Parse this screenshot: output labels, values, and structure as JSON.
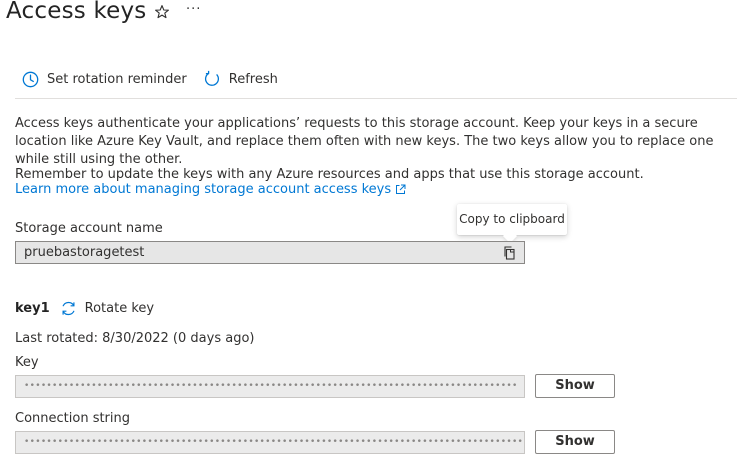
{
  "header": {
    "title": "Access keys",
    "more_label": "···"
  },
  "toolbar": {
    "set_rotation_reminder": "Set rotation reminder",
    "refresh": "Refresh"
  },
  "info": {
    "description": "Access keys authenticate your applications’ requests to this storage account. Keep your keys in a secure location like Azure Key Vault, and replace them often with new keys. The two keys allow you to replace one while still using the other.",
    "reminder": "Remember to update the keys with any Azure resources and apps that use this storage account.",
    "learn_more_link": "Learn more about managing storage account access keys"
  },
  "storage_account": {
    "label": "Storage account name",
    "value": "pruebastoragetest",
    "copy_tooltip": "Copy to clipboard"
  },
  "key1": {
    "name": "key1",
    "rotate_label": "Rotate key",
    "last_rotated": "Last rotated: 8/30/2022 (0 days ago)",
    "key_label": "Key",
    "key_masked": "••••••••••••••••••••••••••••••••••••••••••••••••••••••••••••••••••••••••••••••••••••••••",
    "connection_label": "Connection string",
    "connection_masked": "•••••••••••••••••••••••••••••••••••••••••••••••••••••••••••••••••••••••••••••••••••••••••...",
    "show_label": "Show"
  },
  "icons": {
    "star": "star-icon",
    "more": "more-icon",
    "clock": "clock-icon",
    "refresh": "refresh-icon",
    "external_link": "external-link-icon",
    "copy": "copy-icon",
    "rotate": "rotate-icon"
  },
  "colors": {
    "link": "#0078d4",
    "icon_blue": "#0078d4"
  }
}
